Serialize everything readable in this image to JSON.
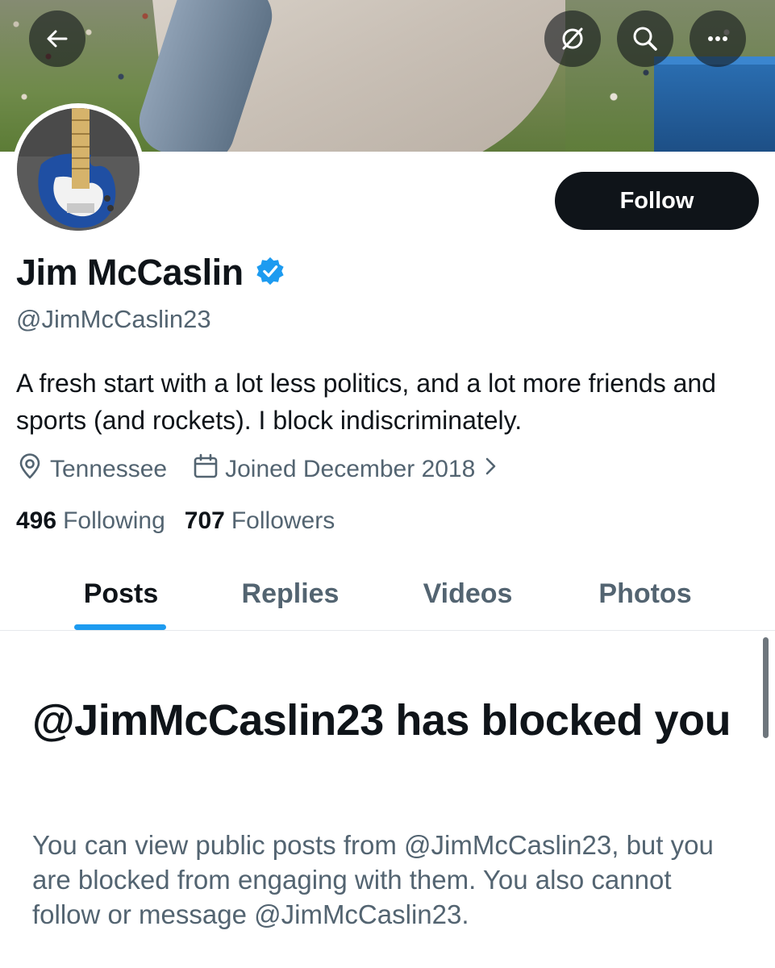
{
  "profile": {
    "name": "Jim McCaslin",
    "handle": "@JimMcCaslin23",
    "bio": "A fresh start with a lot less politics, and a lot more friends and sports (and rockets). I block indiscriminately.",
    "location": "Tennessee",
    "joined": "Joined December 2018",
    "following_count": "496",
    "following_label": "Following",
    "followers_count": "707",
    "followers_label": "Followers",
    "verified_icon": "verified-badge-icon"
  },
  "header": {
    "back_icon": "back-arrow-icon",
    "grok_icon": "grok-icon",
    "search_icon": "search-icon",
    "more_icon": "more-icon"
  },
  "actions": {
    "follow_label": "Follow"
  },
  "tabs": [
    {
      "label": "Posts",
      "active": true
    },
    {
      "label": "Replies",
      "active": false
    },
    {
      "label": "Videos",
      "active": false
    },
    {
      "label": "Photos",
      "active": false
    }
  ],
  "blocked": {
    "title": "@JimMcCaslin23 has blocked you",
    "description": "You can view public posts from @JimMcCaslin23, but you are blocked from engaging with them. You also cannot follow or message @JimMcCaslin23."
  },
  "colors": {
    "accent": "#1d9bf0",
    "text_primary": "#0f1419",
    "text_secondary": "#536471",
    "button_bg": "#0f1419"
  }
}
